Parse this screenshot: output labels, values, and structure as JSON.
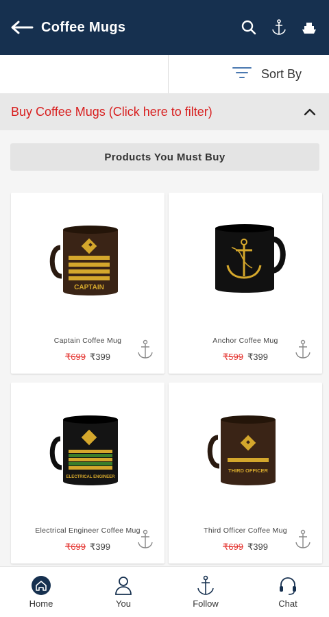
{
  "header": {
    "title": "Coffee Mugs",
    "icons": [
      "back-arrow-icon",
      "search-icon",
      "anchor-icon",
      "ship-icon"
    ]
  },
  "sort": {
    "label": "Sort By"
  },
  "filter": {
    "label": "Buy Coffee Mugs (Click here to filter)"
  },
  "section": {
    "title": "Products You Must Buy"
  },
  "products": [
    {
      "name": "Captain Coffee Mug",
      "mrp": "₹699",
      "price": "₹399",
      "mug_color": "#3a2416",
      "emblem": "CAPTAIN"
    },
    {
      "name": "Anchor Coffee Mug",
      "mrp": "₹599",
      "price": "₹399",
      "mug_color": "#111111",
      "emblem": ""
    },
    {
      "name": "Electrical Engineer Coffee Mug",
      "mrp": "₹699",
      "price": "₹399",
      "mug_color": "#141414",
      "emblem": "ELECTRICAL ENGINEER"
    },
    {
      "name": "Third Officer Coffee Mug",
      "mrp": "₹699",
      "price": "₹399",
      "mug_color": "#3a2416",
      "emblem": "THIRD OFFICER"
    }
  ],
  "bottom_nav": [
    {
      "label": "Home",
      "icon": "home-icon"
    },
    {
      "label": "You",
      "icon": "user-icon"
    },
    {
      "label": "Follow",
      "icon": "anchor-icon"
    },
    {
      "label": "Chat",
      "icon": "headset-icon"
    }
  ],
  "colors": {
    "header_bg": "#16304f",
    "accent_red": "#d81f1f",
    "gold": "#d4a72c",
    "green_band": "#3a7d2a"
  }
}
